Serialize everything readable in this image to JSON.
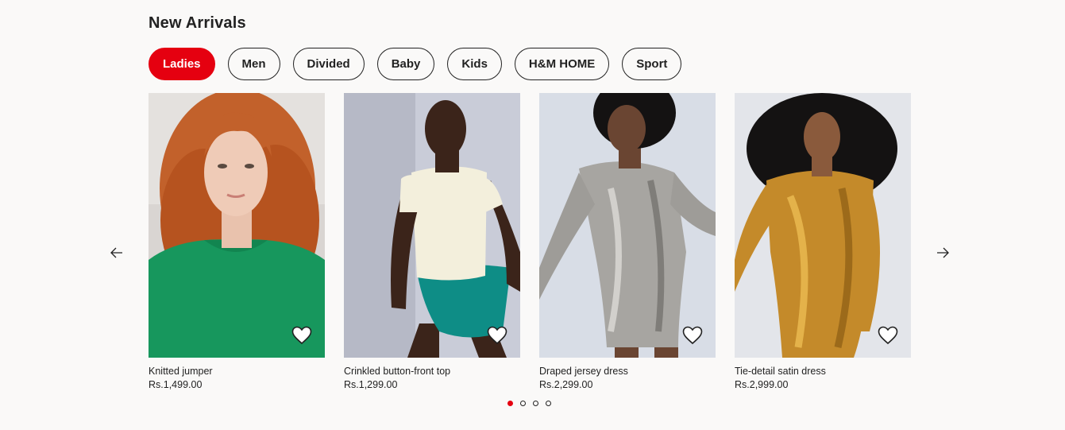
{
  "section": {
    "title": "New Arrivals"
  },
  "tabs": [
    {
      "label": "Ladies",
      "active": true
    },
    {
      "label": "Men",
      "active": false
    },
    {
      "label": "Divided",
      "active": false
    },
    {
      "label": "Baby",
      "active": false
    },
    {
      "label": "Kids",
      "active": false
    },
    {
      "label": "H&M HOME",
      "active": false
    },
    {
      "label": "Sport",
      "active": false
    }
  ],
  "products": [
    {
      "name": "Knitted jumper",
      "price": "Rs.1,499.00",
      "image": "woman-red-curly-hair-green-jumper",
      "fav_icon": "heart-icon"
    },
    {
      "name": "Crinkled button-front top",
      "price": "Rs.1,299.00",
      "image": "woman-cream-top-teal-bottoms",
      "fav_icon": "heart-icon"
    },
    {
      "name": "Draped jersey dress",
      "price": "Rs.2,299.00",
      "image": "woman-silver-metallic-dress",
      "fav_icon": "heart-icon"
    },
    {
      "name": "Tie-detail satin dress",
      "price": "Rs.2,999.00",
      "image": "woman-gold-satin-dress",
      "fav_icon": "heart-icon"
    }
  ],
  "navigation": {
    "prev_icon": "arrow-left-icon",
    "next_icon": "arrow-right-icon"
  },
  "pagination": {
    "total": 4,
    "current": 1
  },
  "colors": {
    "accent": "#e50010",
    "text": "#222222",
    "background": "#faf9f8"
  }
}
